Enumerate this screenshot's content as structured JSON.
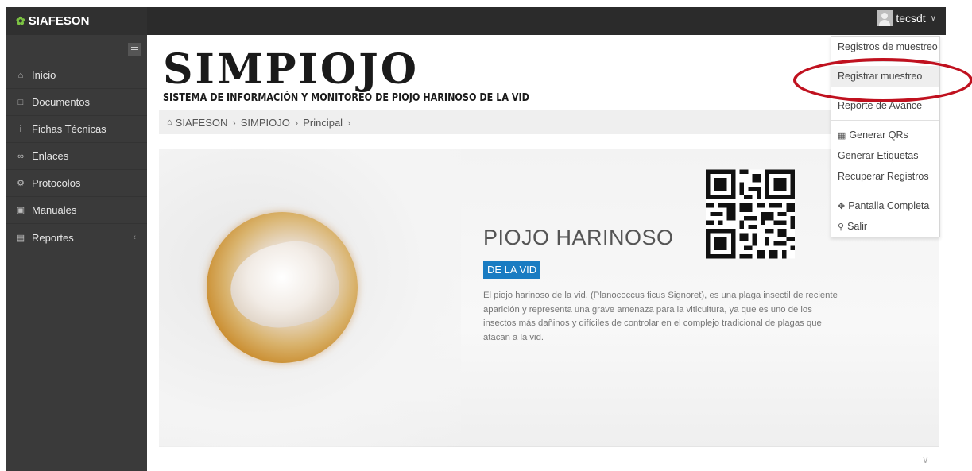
{
  "app": {
    "brand": "SIAFESON"
  },
  "user": {
    "name": "tecsdt"
  },
  "sidebar": {
    "items": [
      {
        "label": "Inicio",
        "icon": "home-icon"
      },
      {
        "label": "Documentos",
        "icon": "folder-icon"
      },
      {
        "label": "Fichas Técnicas",
        "icon": "info-icon"
      },
      {
        "label": "Enlaces",
        "icon": "link-icon"
      },
      {
        "label": "Protocolos",
        "icon": "gear-icon"
      },
      {
        "label": "Manuales",
        "icon": "book-icon"
      },
      {
        "label": "Reportes",
        "icon": "file-icon"
      }
    ]
  },
  "header": {
    "logo_title": "SIMPIOJO",
    "logo_subtitle": "SISTEMA DE INFORMACIÓN Y MONITOREO DE PIOJO HARINOSO DE LA VID"
  },
  "breadcrumb": [
    "SIAFESON",
    "SIMPIOJO",
    "Principal"
  ],
  "hero": {
    "title": "PIOJO HARINOSO",
    "badge": "DE LA VID",
    "description": "El piojo harinoso de la vid, (Planococcus ficus Signoret), es una plaga insectil de reciente aparición y representa una grave amenaza para la viticultura, ya que es uno de los insectos más dañinos y difíciles de controlar en el complejo tradicional de plagas que atacan a la vid."
  },
  "dropdown": {
    "items": [
      "Registros de muestreo",
      "Registrar muestreo",
      "Reporte de Avance",
      "Generar QRs",
      "Generar Etiquetas",
      "Recuperar Registros",
      "Pantalla Completa",
      "Salir"
    ]
  },
  "colors": {
    "accent": "#1a7cc2",
    "annotation": "#c0111f",
    "topbar": "#2b2b2b",
    "sidebar": "#3a3a3a"
  }
}
